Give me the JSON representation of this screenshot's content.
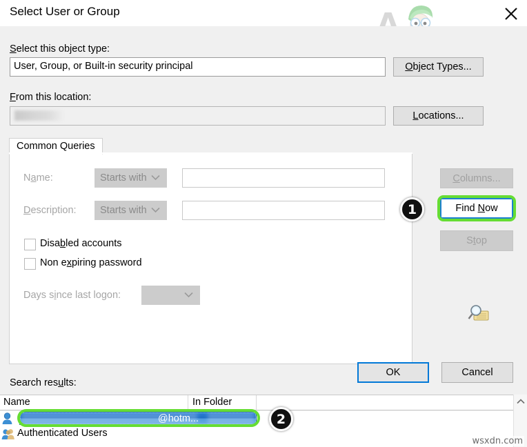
{
  "window": {
    "title": "Select User or Group",
    "close_label": "×"
  },
  "watermark": {
    "brand": "A PUALS",
    "site": "wsxdn.com"
  },
  "object_type": {
    "label": "Select this object type:",
    "value": "User, Group, or Built-in security principal",
    "button": "Object Types..."
  },
  "location": {
    "label": "From this location:",
    "value": "",
    "button": "Locations..."
  },
  "tabs": [
    {
      "label": "Common Queries"
    }
  ],
  "query": {
    "name_label": "Name:",
    "name_operator": "Starts with",
    "name_value": "",
    "description_label": "Description:",
    "description_operator": "Starts with",
    "description_value": "",
    "disabled_accounts_label": "Disabled accounts",
    "disabled_accounts_checked": false,
    "non_expiring_label": "Non expiring password",
    "non_expiring_checked": false,
    "days_label": "Days since last logon:",
    "days_value": ""
  },
  "side_buttons": {
    "columns": "Columns...",
    "find_now": "Find Now",
    "stop": "Stop"
  },
  "dialog_buttons": {
    "ok": "OK",
    "cancel": "Cancel"
  },
  "results": {
    "label": "Search results:",
    "columns": [
      "Name",
      "In Folder"
    ],
    "rows": [
      {
        "name": "@hotm...",
        "folder": "",
        "selected": true,
        "icon": "user-icon"
      },
      {
        "name": "Authenticated Users",
        "folder": "",
        "selected": false,
        "icon": "group-icon"
      }
    ]
  },
  "annotations": [
    {
      "id": "1",
      "target": "find-now-button"
    },
    {
      "id": "2",
      "target": "selected-result-row"
    }
  ],
  "colors": {
    "highlight_ring": "#66dd33",
    "focus_border": "#0078d7",
    "selection_blue": "#2c7fd6",
    "dialog_bg": "#f0f0f0"
  }
}
